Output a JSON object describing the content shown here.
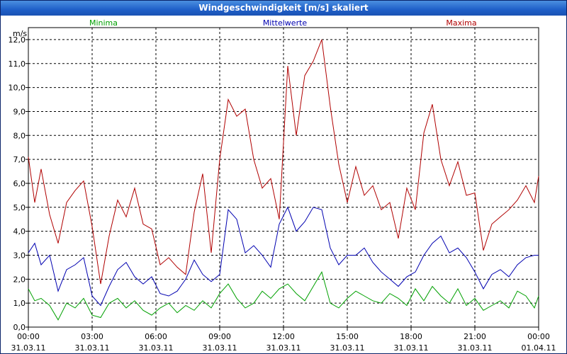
{
  "chart_data": {
    "type": "line",
    "title": "Windgeschwindigkeit [m/s] skaliert",
    "ylabel": "m/s",
    "ylim": [
      0,
      12.5
    ],
    "yticks": [
      "0,0",
      "1,0",
      "2,0",
      "3,0",
      "4,0",
      "5,0",
      "6,0",
      "7,0",
      "8,0",
      "9,0",
      "10,0",
      "11,0",
      "12,0"
    ],
    "xlim": [
      0,
      24
    ],
    "xticks": [
      {
        "time": "00:00",
        "date": "31.03.11"
      },
      {
        "time": "03:00",
        "date": "31.03.11"
      },
      {
        "time": "06:00",
        "date": "31.03.11"
      },
      {
        "time": "09:00",
        "date": "31.03.11"
      },
      {
        "time": "12:00",
        "date": "31.03.11"
      },
      {
        "time": "15:00",
        "date": "31.03.11"
      },
      {
        "time": "18:00",
        "date": "31.03.11"
      },
      {
        "time": "21:00",
        "date": "31.03.11"
      },
      {
        "time": "00:00",
        "date": "01.04.11"
      }
    ],
    "grid": true,
    "legend": "top",
    "series": [
      {
        "name": "Minima",
        "color": "#00a000",
        "x": [
          0,
          0.3,
          0.6,
          1.0,
          1.4,
          1.8,
          2.2,
          2.6,
          3.0,
          3.4,
          3.8,
          4.2,
          4.6,
          5.0,
          5.4,
          5.8,
          6.2,
          6.6,
          7.0,
          7.4,
          7.8,
          8.2,
          8.6,
          9.0,
          9.4,
          9.8,
          10.2,
          10.6,
          11.0,
          11.4,
          11.8,
          12.2,
          12.6,
          13.0,
          13.4,
          13.8,
          14.2,
          14.6,
          15.0,
          15.4,
          15.8,
          16.2,
          16.6,
          17.0,
          17.4,
          17.8,
          18.2,
          18.6,
          19.0,
          19.4,
          19.8,
          20.2,
          20.6,
          21.0,
          21.4,
          21.8,
          22.2,
          22.6,
          23.0,
          23.4,
          23.8,
          24.0
        ],
        "y": [
          1.6,
          1.1,
          1.2,
          0.9,
          0.3,
          1.0,
          0.8,
          1.2,
          0.5,
          0.4,
          1.0,
          1.2,
          0.8,
          1.1,
          0.7,
          0.5,
          0.8,
          1.0,
          0.6,
          0.9,
          0.7,
          1.1,
          0.8,
          1.4,
          1.8,
          1.2,
          0.8,
          1.0,
          1.5,
          1.2,
          1.6,
          1.8,
          1.4,
          1.1,
          1.7,
          2.3,
          1.0,
          0.8,
          1.2,
          1.5,
          1.3,
          1.1,
          1.0,
          1.4,
          1.2,
          0.9,
          1.6,
          1.1,
          1.7,
          1.3,
          1.0,
          1.6,
          0.9,
          1.2,
          0.7,
          0.9,
          1.1,
          0.8,
          1.5,
          1.3,
          0.8,
          1.3
        ]
      },
      {
        "name": "Mittelwerte",
        "color": "#0000b0",
        "x": [
          0,
          0.3,
          0.6,
          1.0,
          1.4,
          1.8,
          2.2,
          2.6,
          3.0,
          3.4,
          3.8,
          4.2,
          4.6,
          5.0,
          5.4,
          5.8,
          6.2,
          6.6,
          7.0,
          7.4,
          7.8,
          8.2,
          8.6,
          9.0,
          9.4,
          9.8,
          10.2,
          10.6,
          11.0,
          11.4,
          11.8,
          12.2,
          12.6,
          13.0,
          13.4,
          13.8,
          14.2,
          14.6,
          15.0,
          15.4,
          15.8,
          16.2,
          16.6,
          17.0,
          17.4,
          17.8,
          18.2,
          18.6,
          19.0,
          19.4,
          19.8,
          20.2,
          20.6,
          21.0,
          21.4,
          21.8,
          22.2,
          22.6,
          23.0,
          23.4,
          23.8,
          24.0
        ],
        "y": [
          3.1,
          3.5,
          2.6,
          3.0,
          1.5,
          2.4,
          2.6,
          2.9,
          1.3,
          0.9,
          1.7,
          2.4,
          2.7,
          2.1,
          1.8,
          2.1,
          1.4,
          1.3,
          1.5,
          2.0,
          2.8,
          2.2,
          1.9,
          2.2,
          4.9,
          4.5,
          3.1,
          3.4,
          3.0,
          2.5,
          4.3,
          5.0,
          4.0,
          4.4,
          5.0,
          4.9,
          3.3,
          2.6,
          3.0,
          3.0,
          3.3,
          2.7,
          2.3,
          2.0,
          1.7,
          2.1,
          2.3,
          3.0,
          3.5,
          3.8,
          3.1,
          3.3,
          2.9,
          2.3,
          1.6,
          2.2,
          2.4,
          2.1,
          2.6,
          2.9,
          3.0,
          3.0
        ]
      },
      {
        "name": "Maxima",
        "color": "#b00000",
        "x": [
          0,
          0.3,
          0.6,
          1.0,
          1.4,
          1.8,
          2.2,
          2.6,
          3.0,
          3.4,
          3.8,
          4.2,
          4.6,
          5.0,
          5.4,
          5.8,
          6.2,
          6.6,
          7.0,
          7.4,
          7.8,
          8.2,
          8.6,
          9.0,
          9.4,
          9.8,
          10.2,
          10.6,
          11.0,
          11.4,
          11.8,
          12.2,
          12.6,
          13.0,
          13.4,
          13.8,
          14.2,
          14.6,
          15.0,
          15.4,
          15.8,
          16.2,
          16.6,
          17.0,
          17.4,
          17.8,
          18.2,
          18.6,
          19.0,
          19.4,
          19.8,
          20.2,
          20.6,
          21.0,
          21.4,
          21.8,
          22.2,
          22.6,
          23.0,
          23.4,
          23.8,
          24.0
        ],
        "y": [
          7.1,
          5.2,
          6.6,
          4.7,
          3.5,
          5.2,
          5.7,
          6.1,
          4.2,
          1.8,
          3.8,
          5.3,
          4.6,
          5.8,
          4.3,
          4.1,
          2.6,
          2.9,
          2.5,
          2.2,
          4.8,
          6.4,
          3.1,
          7.0,
          9.5,
          8.8,
          9.1,
          7.0,
          5.8,
          6.2,
          4.5,
          10.9,
          8.0,
          10.5,
          11.1,
          12.0,
          9.2,
          6.8,
          5.2,
          6.7,
          5.5,
          5.9,
          4.9,
          5.2,
          3.7,
          5.8,
          4.9,
          8.1,
          9.3,
          7.0,
          5.9,
          6.9,
          5.5,
          5.6,
          3.2,
          4.3,
          4.6,
          4.9,
          5.3,
          5.9,
          5.2,
          6.3
        ]
      }
    ]
  }
}
